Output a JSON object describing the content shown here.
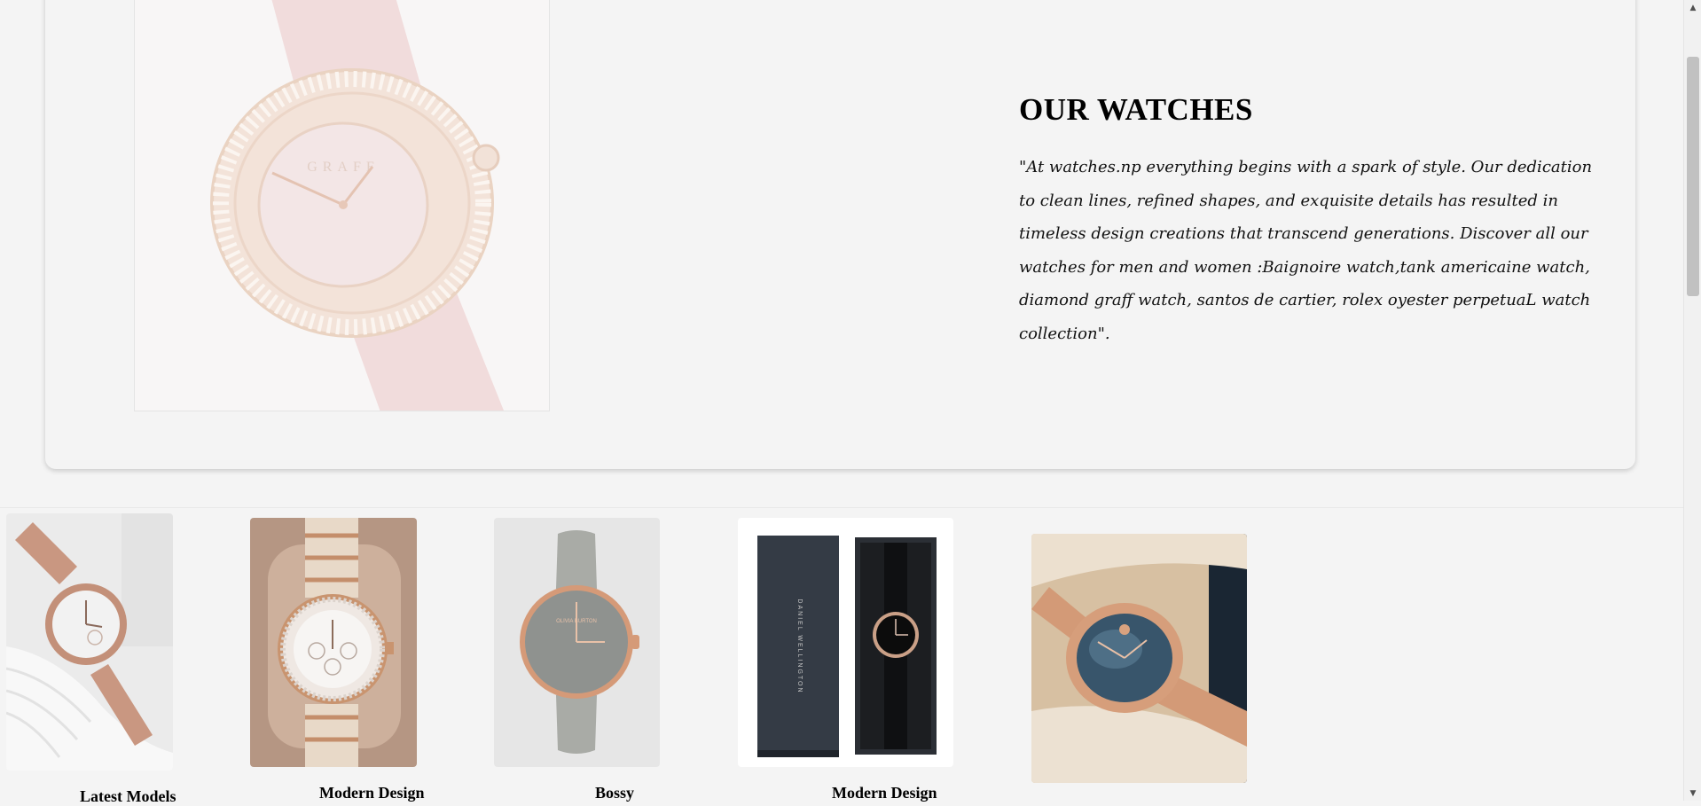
{
  "hero": {
    "title": "OUR WATCHES",
    "description": "\"At watches.np everything begins with a spark of style. Our dedication to clean lines, refined shapes, and exquisite details has resulted in timeless design creations that transcend generations. Discover all our watches for men and women :Baignoire watch,tank americaine watch, diamond graff watch, santos de cartier, rolex oyester perpetuaL watch collection\".",
    "image_icon": "diamond-watch-image"
  },
  "products": [
    {
      "name": "Latest Models",
      "image_icon": "rose-gold-bracelet-watch-image"
    },
    {
      "name": "Modern Design",
      "image_icon": "crystal-bezel-watch-image"
    },
    {
      "name": "Bossy",
      "image_icon": "grey-leather-watch-image"
    },
    {
      "name": "Modern Design",
      "image_icon": "boxed-black-watch-image"
    },
    {
      "name": "",
      "image_icon": "blue-dial-watch-image"
    }
  ],
  "colors": {
    "background": "#f4f4f4",
    "rose_gold": "#d8a58c",
    "text": "#000000",
    "scrollbar_thumb": "#c1c1c1"
  }
}
